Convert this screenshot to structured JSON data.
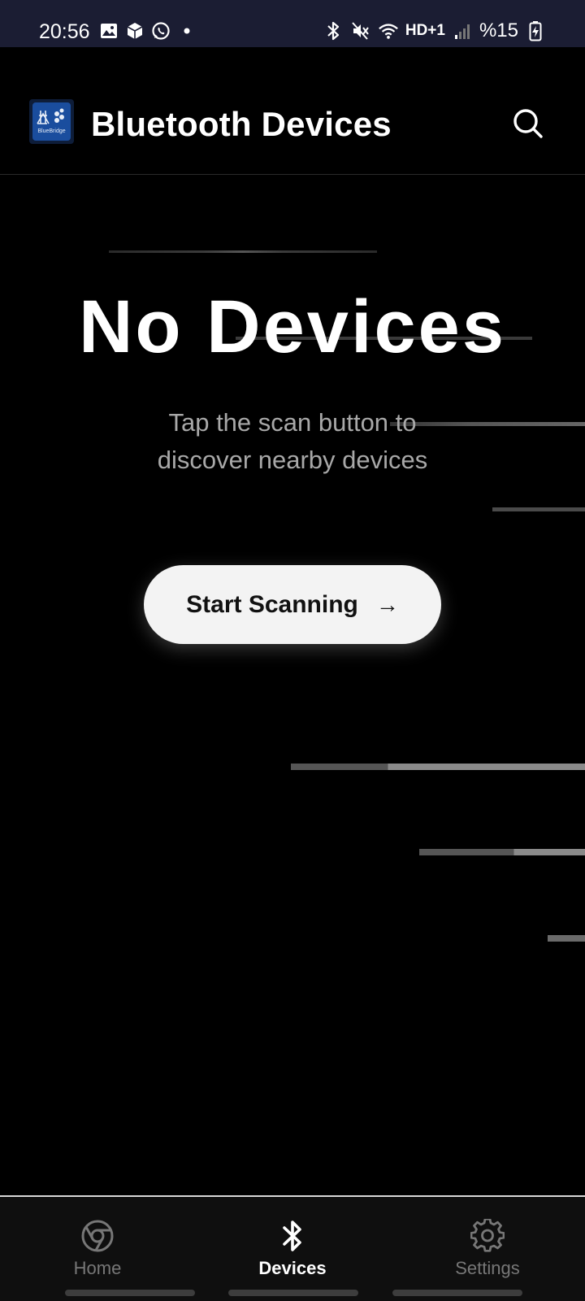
{
  "status_bar": {
    "time": "20:56",
    "battery_text": "%15",
    "left_icons": [
      "gallery-icon",
      "package-icon",
      "whatsapp-icon",
      "dot-icon"
    ],
    "right_icons": [
      "bluetooth-icon",
      "mute-icon",
      "wifi-icon",
      "hd-plus-icon",
      "signal-icon",
      "battery-charging-icon"
    ],
    "network_label": "HD+1"
  },
  "app_bar": {
    "logo_text": "BlueBridge",
    "title": "Bluetooth Devices",
    "search_icon": "search-icon"
  },
  "empty_state": {
    "title": "No Devices",
    "subtitle_line1": "Tap the scan button to",
    "subtitle_line2": "discover nearby devices",
    "button_label": "Start Scanning",
    "button_arrow": "→"
  },
  "bottom_nav": {
    "items": [
      {
        "label": "Home",
        "icon": "chrome-icon",
        "active": false
      },
      {
        "label": "Devices",
        "icon": "bluetooth-icon",
        "active": true
      },
      {
        "label": "Settings",
        "icon": "gear-icon",
        "active": false
      }
    ]
  },
  "colors": {
    "background": "#000000",
    "status_bar": "#1b1d33",
    "button_bg": "#f3f3f3",
    "subtitle": "#a8a8a8",
    "nav_inactive": "#777777"
  }
}
